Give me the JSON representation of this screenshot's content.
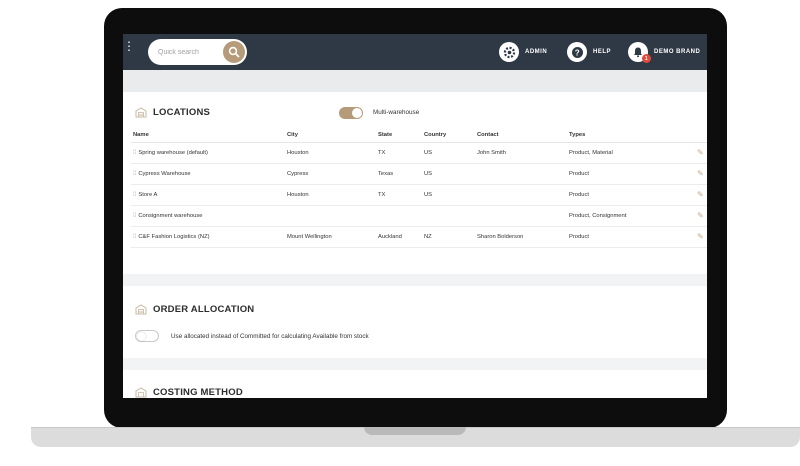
{
  "topbar": {
    "search_placeholder": "Quick search",
    "admin_label": "ADMIN",
    "help_label": "HELP",
    "notifications_count": "1",
    "user_label": "DEMO BRAND"
  },
  "locations": {
    "title": "LOCATIONS",
    "multi_warehouse_label": "Multi-warehouse",
    "multi_warehouse_enabled": true,
    "columns": [
      "Name",
      "City",
      "State",
      "Country",
      "Contact",
      "Types"
    ],
    "rows": [
      {
        "name": "Spring warehouse (default)",
        "city": "Houston",
        "state": "TX",
        "country": "US",
        "contact": "John Smith",
        "types": "Product, Material"
      },
      {
        "name": "Cypress Warehouse",
        "city": "Cypress",
        "state": "Texas",
        "country": "US",
        "contact": "",
        "types": "Product"
      },
      {
        "name": "Store A",
        "city": "Houston",
        "state": "TX",
        "country": "US",
        "contact": "",
        "types": "Product"
      },
      {
        "name": "Consignment warehouse",
        "city": "",
        "state": "",
        "country": "",
        "contact": "",
        "types": "Product, Consignment"
      },
      {
        "name": "C&F Fashion Logistics (NZ)",
        "city": "Mount Wellington",
        "state": "Auckland",
        "country": "NZ",
        "contact": "Sharon Bolderson",
        "types": "Product"
      }
    ]
  },
  "order_allocation": {
    "title": "ORDER ALLOCATION",
    "option_label": "Use allocated instead of Committed for calculating Available from stock",
    "option_enabled": false
  },
  "costing_method": {
    "title": "COSTING METHOD"
  },
  "colors": {
    "accent": "#b59b7a",
    "topbar": "#2f3845",
    "badge": "#e24b3b"
  }
}
